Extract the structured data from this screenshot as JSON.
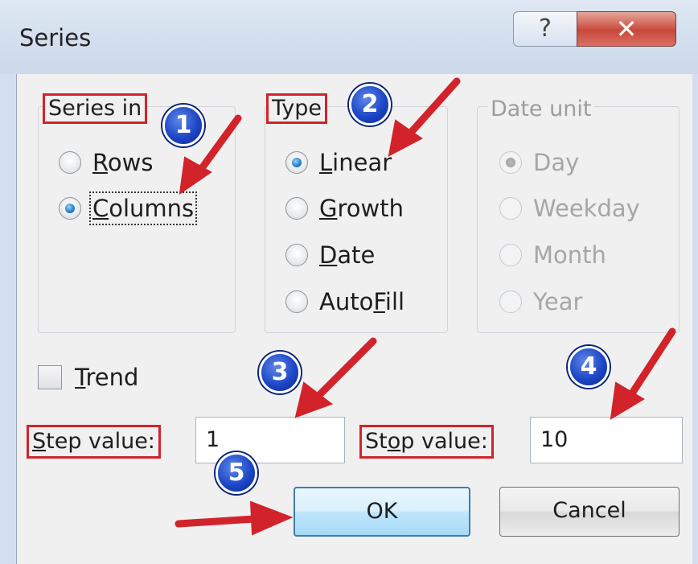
{
  "window": {
    "title": "Series",
    "help_glyph": "?",
    "close_glyph": "✕"
  },
  "series_in": {
    "label": "Series in",
    "options": [
      {
        "pre": "",
        "acc": "R",
        "post": "ows",
        "checked": false
      },
      {
        "pre": "",
        "acc": "C",
        "post": "olumns",
        "checked": true
      }
    ]
  },
  "type": {
    "label": "Type",
    "options": [
      {
        "pre": "",
        "acc": "L",
        "post": "inear",
        "checked": true
      },
      {
        "pre": "",
        "acc": "G",
        "post": "rowth",
        "checked": false
      },
      {
        "pre": "",
        "acc": "D",
        "post": "ate",
        "checked": false
      },
      {
        "pre": "Auto",
        "acc": "F",
        "post": "ill",
        "checked": false
      }
    ]
  },
  "date_unit": {
    "label": "Date unit",
    "options": [
      {
        "label": "Day",
        "checked": true
      },
      {
        "label": "Weekday",
        "checked": false
      },
      {
        "label": "Month",
        "checked": false
      },
      {
        "label": "Year",
        "checked": false
      }
    ]
  },
  "trend": {
    "pre": "",
    "acc": "T",
    "post": "rend",
    "checked": false
  },
  "step": {
    "pre": "",
    "acc": "S",
    "post": "tep value:",
    "value": "1"
  },
  "stop": {
    "pre": "St",
    "acc": "o",
    "post": "p value:",
    "value": "10"
  },
  "buttons": {
    "ok": "OK",
    "cancel": "Cancel"
  },
  "badges": [
    "1",
    "2",
    "3",
    "4",
    "5"
  ],
  "colors": {
    "annotation_red": "#d2232a",
    "badge_blue": "#1d47c7",
    "accent_blue": "#2a83c9"
  }
}
